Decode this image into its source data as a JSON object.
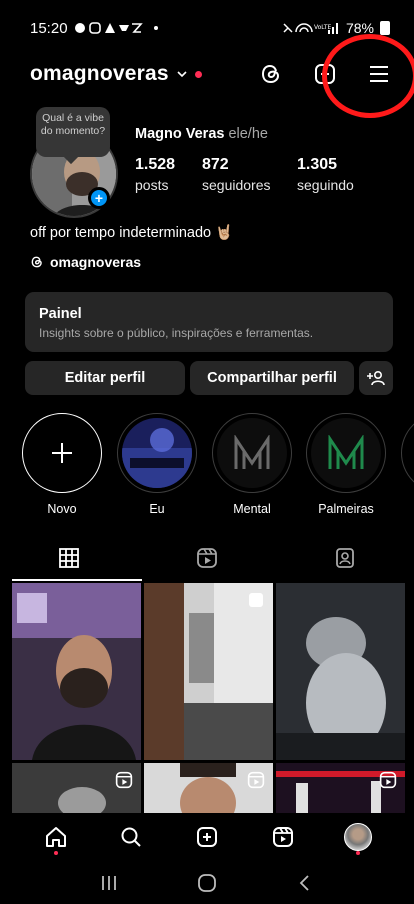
{
  "status_bar": {
    "time": "15:20",
    "battery": "78%"
  },
  "header": {
    "username": "omagnoveras"
  },
  "profile": {
    "note": "Qual é a vibe do momento?",
    "full_name": "Magno Veras",
    "pronouns": "ele/he",
    "stats": [
      {
        "value": "1.528",
        "label": "posts"
      },
      {
        "value": "872",
        "label": "seguidores"
      },
      {
        "value": "1.305",
        "label": "seguindo"
      }
    ],
    "bio": "off por tempo indeterminado 🤘🏼",
    "threads_handle": "omagnoveras"
  },
  "dashboard": {
    "title": "Painel",
    "subtitle": "Insights sobre o público, inspirações e ferramentas."
  },
  "actions": {
    "edit_profile": "Editar perfil",
    "share_profile": "Compartilhar perfil"
  },
  "highlights": [
    {
      "label": "Novo"
    },
    {
      "label": "Eu"
    },
    {
      "label": "Mental"
    },
    {
      "label": "Palmeiras"
    }
  ],
  "colors": {
    "accent_blue": "#0095f6",
    "notification_red": "#ff2d55",
    "annotation_red": "#ff1a1a",
    "surface": "#262626",
    "palmeiras_green": "#1f8a4c"
  },
  "icons": {
    "tabs": [
      "grid-icon",
      "reels-icon",
      "tagged-icon"
    ],
    "bottom_nav": [
      "home-icon",
      "search-icon",
      "create-icon",
      "reels-icon",
      "profile-avatar"
    ]
  }
}
